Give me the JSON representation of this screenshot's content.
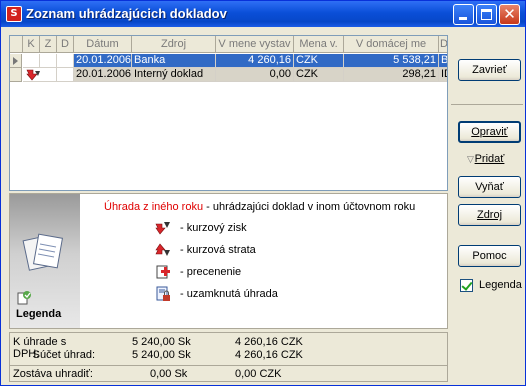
{
  "window": {
    "title": "Zoznam uhrádzajúcich dokladov",
    "app_icon_letter": "S",
    "buttons": {
      "minimize": "minimize",
      "maximize": "maximize",
      "close": "✕"
    }
  },
  "grid": {
    "columns": [
      "K",
      "Z",
      "D",
      "Dátum",
      "Zdroj",
      "V mene vystav",
      "Mena v.",
      "V domácej me",
      "D"
    ],
    "rows": [
      {
        "date": "20.01.2006",
        "source": "Banka",
        "amount_doc": "4 260,16",
        "currency": "CZK",
        "amount_home": "5 538,21",
        "extra": "B",
        "selected": true,
        "icon": ""
      },
      {
        "date": "20.01.2006",
        "source": "Interný doklad",
        "amount_doc": "0,00",
        "currency": "CZK",
        "amount_home": "298,21",
        "extra": "ID",
        "selected": false,
        "icon": "exchange-gain-icon"
      }
    ]
  },
  "legend": {
    "title": "Legenda",
    "other_year_label": "Úhrada z iného roku",
    "other_year_desc": " - uhrádzajúci doklad v inom účtovnom roku",
    "items": [
      {
        "icon": "exchange-gain-icon",
        "text": "- kurzový zisk"
      },
      {
        "icon": "exchange-loss-icon",
        "text": "- kurzová strata"
      },
      {
        "icon": "revaluation-icon",
        "text": "- precenenie"
      },
      {
        "icon": "locked-payment-icon",
        "text": "- uzamknutá úhrada"
      }
    ]
  },
  "summary": {
    "rows": [
      {
        "label": "K úhrade s DPH:",
        "value1": "5 240,00 Sk",
        "value2": "4 260,16 CZK"
      },
      {
        "label": "Súčet úhrad:",
        "value1": "5 240,00 Sk",
        "value2": "4 260,16 CZK"
      },
      {
        "label": "Zostáva uhradiť:",
        "value1": "0,00 Sk",
        "value2": "0,00 CZK"
      }
    ]
  },
  "buttons": {
    "close": "Zavrieť",
    "edit": "Opraviť",
    "add": "Pridať",
    "remove": "Vyňať",
    "source": "Zdroj",
    "help": "Pomoc"
  },
  "legend_checkbox": {
    "label": "Legenda",
    "checked": true
  },
  "colors": {
    "selection": "#316ac5",
    "accent_red": "#e00000",
    "title_blue": "#0a4fd8"
  }
}
